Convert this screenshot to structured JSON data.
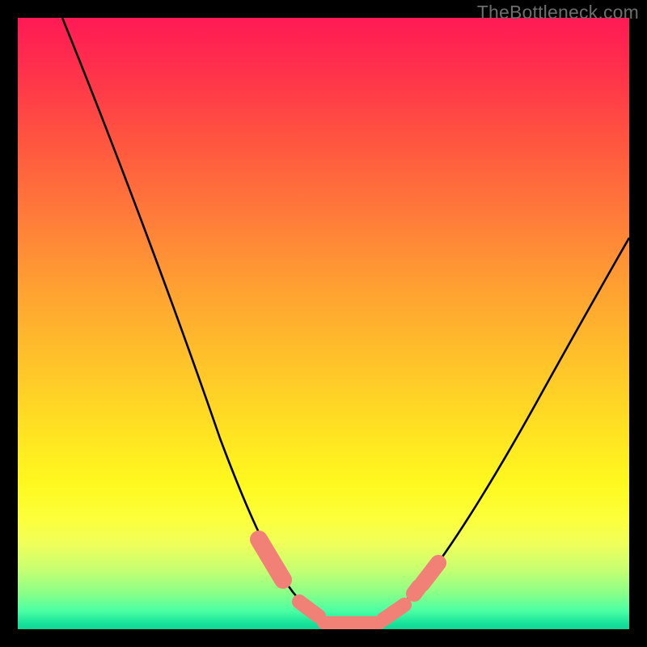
{
  "watermark": {
    "text": "TheBottleneck.com"
  },
  "colors": {
    "frame": "#000000",
    "curve_stroke": "#000000",
    "highlight_fill": "#f18076",
    "watermark_text": "#6d6d6d",
    "gradient_stops": [
      "#ff1a55",
      "#ff2f4c",
      "#ff5540",
      "#ff7a3a",
      "#ffa032",
      "#ffc22a",
      "#ffe322",
      "#fff81f",
      "#fcff3a",
      "#f0ff5a",
      "#caff70",
      "#8cff87",
      "#4bffa4",
      "#18e39a",
      "#12d596"
    ]
  },
  "chart_data": {
    "type": "line",
    "title": "",
    "xlabel": "",
    "ylabel": "",
    "xlim": [
      0,
      100
    ],
    "ylim": [
      0,
      100
    ],
    "grid": false,
    "legend": false,
    "series": [
      {
        "name": "bottleneck-curve",
        "x": [
          10,
          14,
          18,
          22,
          26,
          30,
          34,
          36,
          38,
          40,
          42,
          44,
          46,
          48,
          50,
          52,
          54,
          56,
          58,
          60,
          62,
          64,
          66,
          70,
          74,
          78,
          82,
          86,
          90,
          94,
          98,
          100
        ],
        "y": [
          99,
          90,
          81,
          72,
          63,
          54,
          45,
          40,
          35,
          30,
          25,
          20,
          15,
          10,
          6,
          3,
          1,
          1,
          1,
          2,
          4,
          7,
          11,
          18,
          25,
          32,
          39,
          46,
          52,
          57,
          62,
          64
        ]
      }
    ],
    "highlight_segments": [
      {
        "x_range": [
          39,
          44
        ],
        "y": 3,
        "note": "left sweet-spot blob"
      },
      {
        "x_range": [
          47,
          58
        ],
        "y": 1,
        "note": "bottom sweet-spot band"
      },
      {
        "x_range": [
          60,
          64
        ],
        "y": 3,
        "note": "right sweet-spot blob"
      }
    ],
    "note": "No axis ticks or numeric labels are rendered in the source image; x/y values are estimated from pixel positions on a normalized 0–100 scale. The curve represents percentage bottleneck; the colored band at the bottom marks the optimal (near-zero bottleneck) region."
  }
}
